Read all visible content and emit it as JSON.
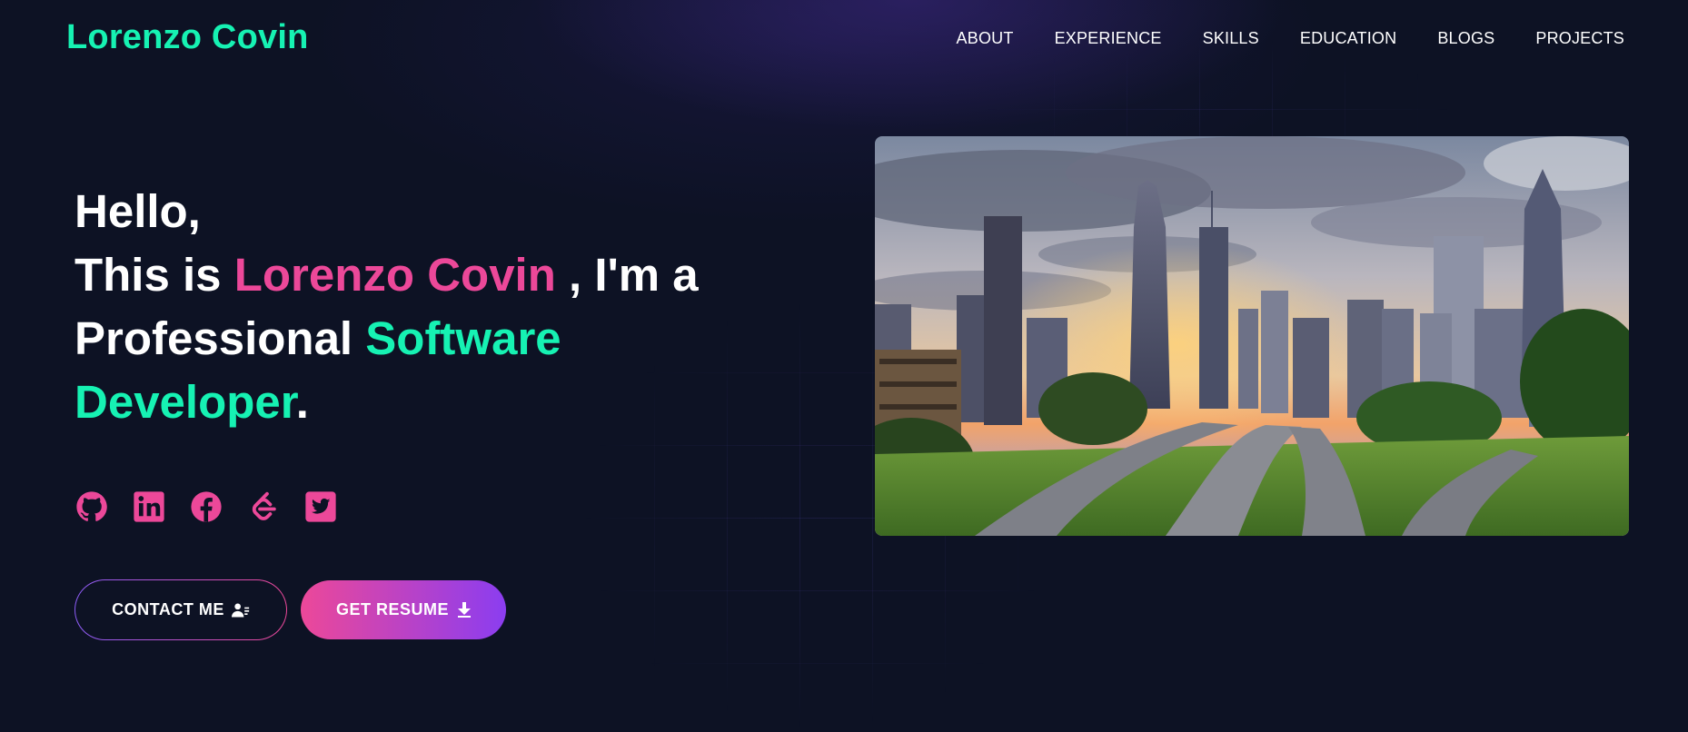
{
  "brand": {
    "name": "Lorenzo Covin"
  },
  "nav": {
    "items": [
      {
        "label": "ABOUT"
      },
      {
        "label": "EXPERIENCE"
      },
      {
        "label": "SKILLS"
      },
      {
        "label": "EDUCATION"
      },
      {
        "label": "BLOGS"
      },
      {
        "label": "PROJECTS"
      }
    ]
  },
  "hero": {
    "greeting": "Hello,",
    "intro_prefix": "This is ",
    "name": "Lorenzo Covin",
    "intro_suffix": " , I'm a",
    "role_prefix": "Professional ",
    "role_highlight_1": "Software",
    "role_highlight_2": "Developer",
    "period": "."
  },
  "social": [
    {
      "icon": "github-icon"
    },
    {
      "icon": "linkedin-icon"
    },
    {
      "icon": "facebook-icon"
    },
    {
      "icon": "leetcode-icon"
    },
    {
      "icon": "twitter-icon"
    }
  ],
  "buttons": {
    "contact_label": "CONTACT ME",
    "resume_label": "GET RESUME"
  },
  "colors": {
    "accent_green": "#16f2b3",
    "accent_pink": "#ec4899",
    "accent_purple": "#8b5cf6",
    "background": "#0d1224"
  }
}
